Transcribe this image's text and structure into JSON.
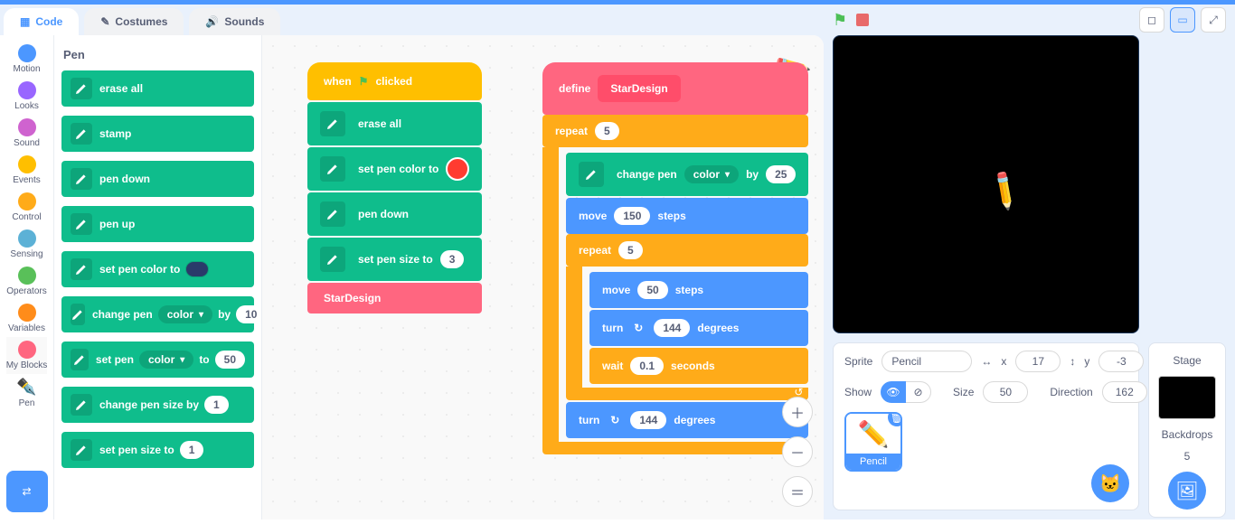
{
  "tabs": {
    "code": "Code",
    "costumes": "Costumes",
    "sounds": "Sounds"
  },
  "categories": [
    {
      "name": "Motion",
      "color": "#4c97ff"
    },
    {
      "name": "Looks",
      "color": "#9966ff"
    },
    {
      "name": "Sound",
      "color": "#cf63cf"
    },
    {
      "name": "Events",
      "color": "#ffbf00"
    },
    {
      "name": "Control",
      "color": "#ffab19"
    },
    {
      "name": "Sensing",
      "color": "#5cb1d6"
    },
    {
      "name": "Operators",
      "color": "#59c059"
    },
    {
      "name": "Variables",
      "color": "#ff8c1a"
    },
    {
      "name": "My Blocks",
      "color": "#ff6680"
    },
    {
      "name": "Pen",
      "color": "#0fbd8c",
      "icon": true
    }
  ],
  "palette": {
    "title": "Pen",
    "blocks": {
      "erase_all": "erase all",
      "stamp": "stamp",
      "pen_down": "pen down",
      "pen_up": "pen up",
      "set_pen_color": "set pen color to",
      "change_pen": {
        "pre": "change pen",
        "dd": "color",
        "mid": "by",
        "val": "10"
      },
      "set_pen": {
        "pre": "set pen",
        "dd": "color",
        "mid": "to",
        "val": "50"
      },
      "change_pen_size": {
        "pre": "change pen size by",
        "val": "1"
      },
      "set_pen_size": {
        "pre": "set pen size to",
        "val": "1"
      }
    }
  },
  "script1": {
    "hat": {
      "when": "when",
      "clicked": "clicked"
    },
    "erase_all": "erase all",
    "set_color": "set pen color to",
    "pen_down": "pen down",
    "set_size": {
      "label": "set pen size to",
      "val": "3"
    },
    "call": "StarDesign"
  },
  "script2": {
    "define": "define",
    "name": "StarDesign",
    "repeat": "repeat",
    "r1": "5",
    "change_pen": {
      "pre": "change pen",
      "dd": "color",
      "mid": "by",
      "val": "25"
    },
    "move1": {
      "pre": "move",
      "val": "150",
      "post": "steps"
    },
    "r2": "5",
    "move2": {
      "pre": "move",
      "val": "50",
      "post": "steps"
    },
    "turn1": {
      "pre": "turn",
      "val": "144",
      "post": "degrees"
    },
    "wait": {
      "pre": "wait",
      "val": "0.1",
      "post": "seconds"
    },
    "turn2": {
      "pre": "turn",
      "val": "144",
      "post": "degrees"
    }
  },
  "sprite_panel": {
    "sprite_label": "Sprite",
    "sprite_name": "Pencil",
    "x_label": "x",
    "x": "17",
    "y_label": "y",
    "y": "-3",
    "show_label": "Show",
    "size_label": "Size",
    "size": "50",
    "dir_label": "Direction",
    "dir": "162",
    "card": "Pencil"
  },
  "stage_side": {
    "title": "Stage",
    "backdrops": "Backdrops",
    "count": "5"
  }
}
